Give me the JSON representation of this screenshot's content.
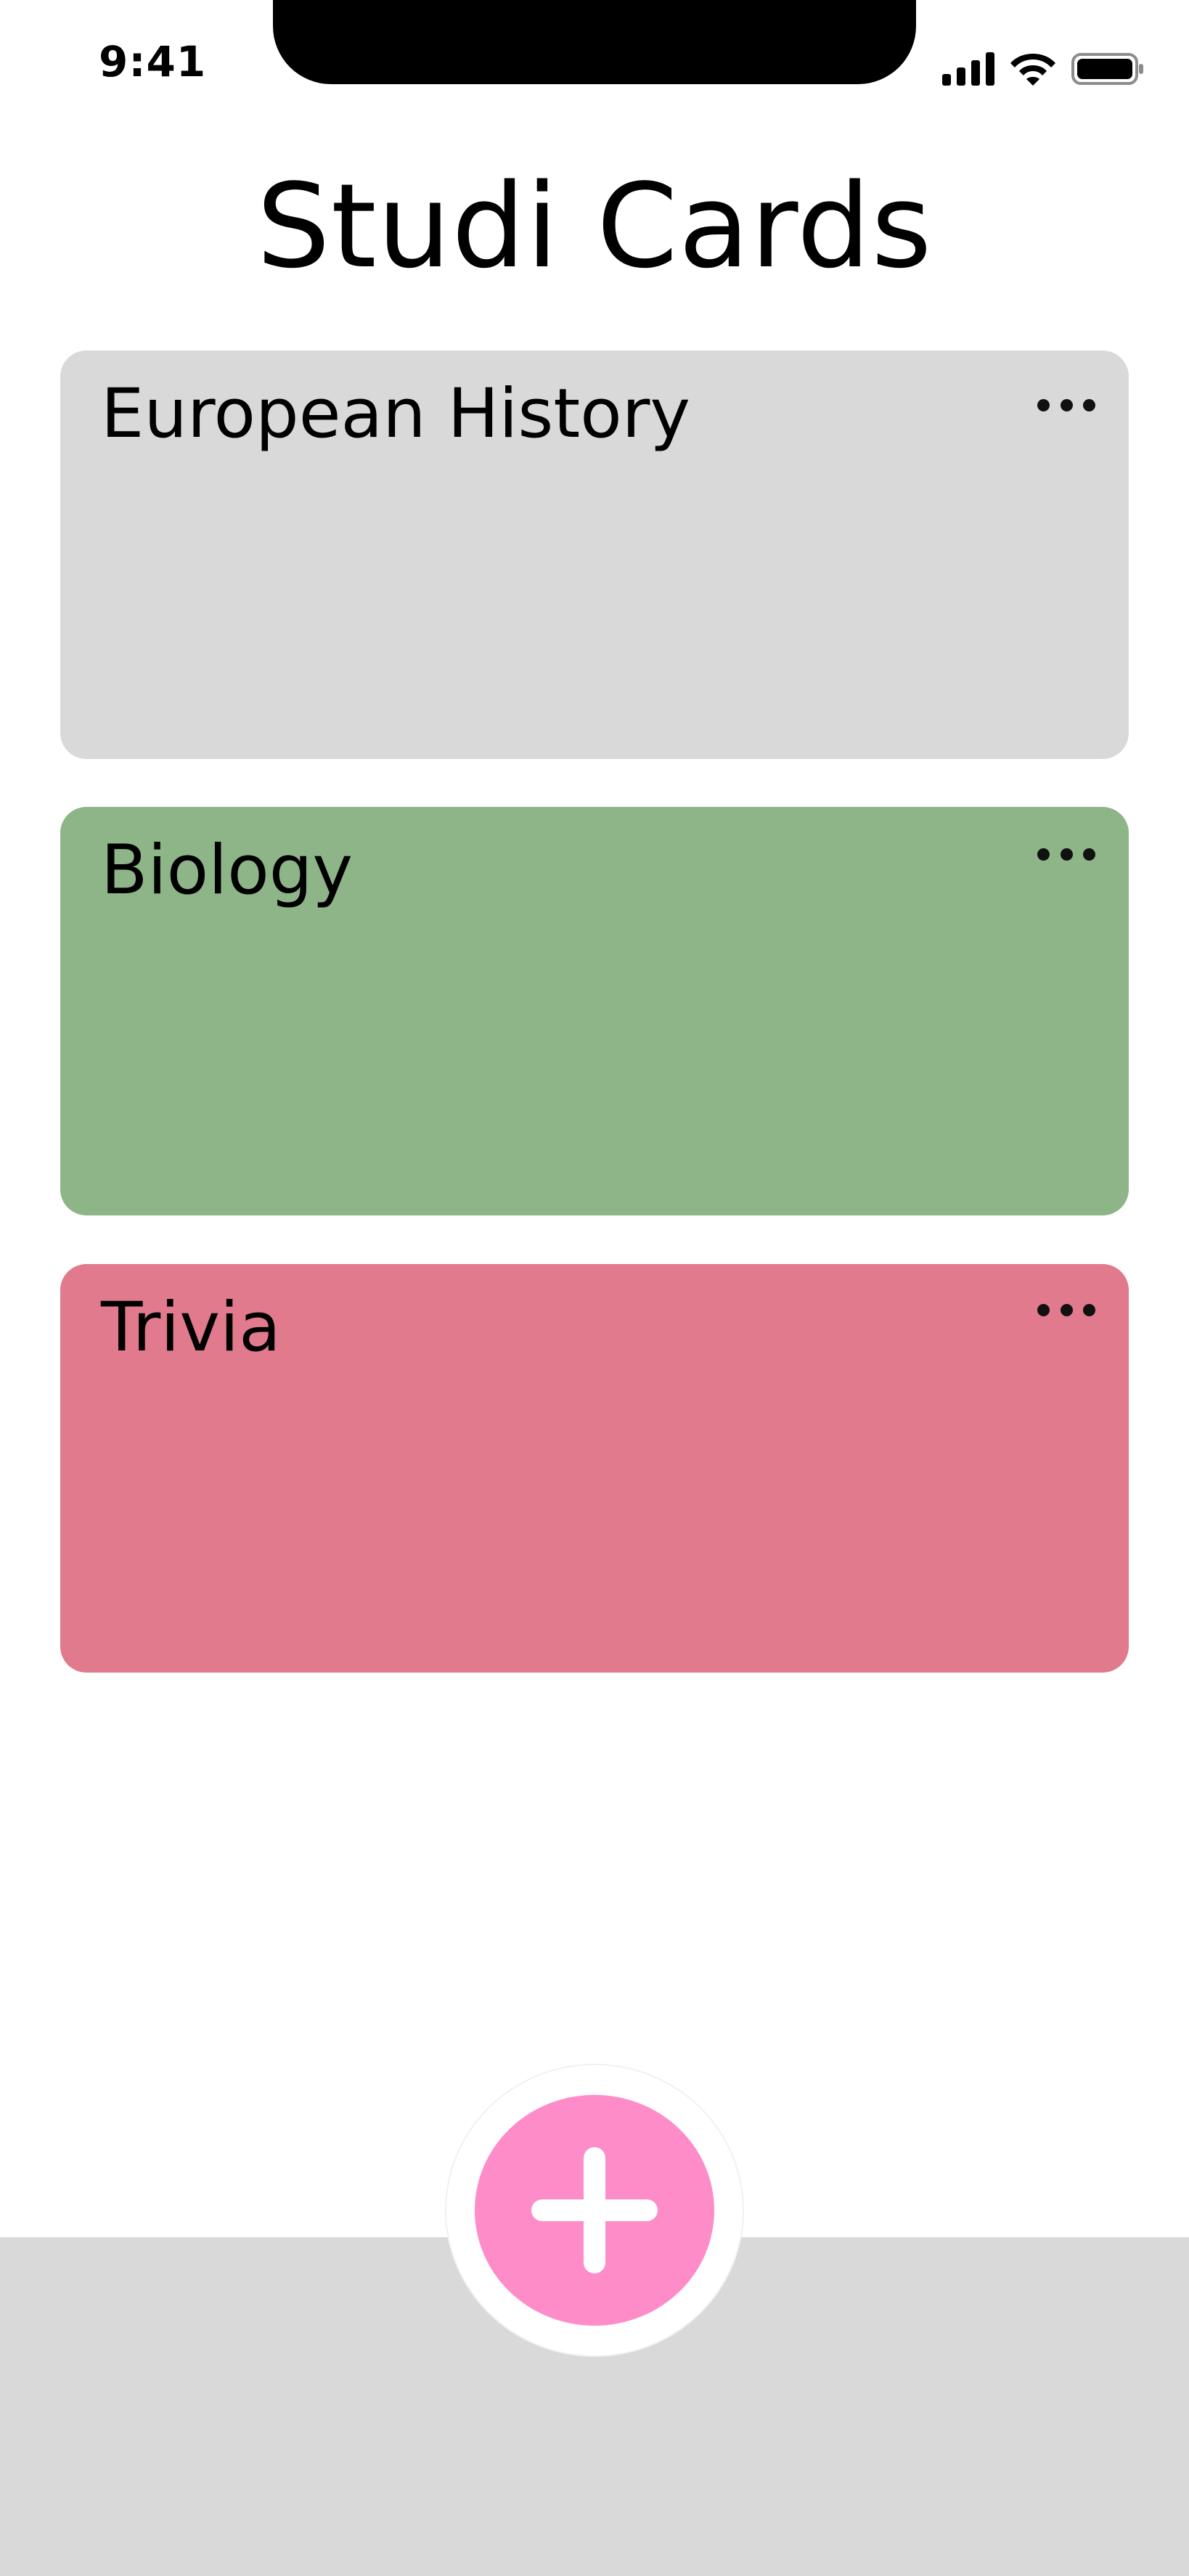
{
  "status_bar": {
    "time": "9:41",
    "icons": [
      "cellular-signal-icon",
      "wifi-icon",
      "battery-icon"
    ]
  },
  "header": {
    "title": "Studi Cards"
  },
  "decks": [
    {
      "title": "European History",
      "color": "#d9d9d9",
      "menu_icon": "more-horizontal-icon"
    },
    {
      "title": "Biology",
      "color": "#8db588",
      "menu_icon": "more-horizontal-icon"
    },
    {
      "title": "Trivia",
      "color": "#e17a8c",
      "menu_icon": "more-horizontal-icon"
    }
  ],
  "bottom_bar": {
    "color": "#d9d9d9",
    "add_button_color": "#fe8cc9",
    "add_button_icon": "plus-icon"
  }
}
